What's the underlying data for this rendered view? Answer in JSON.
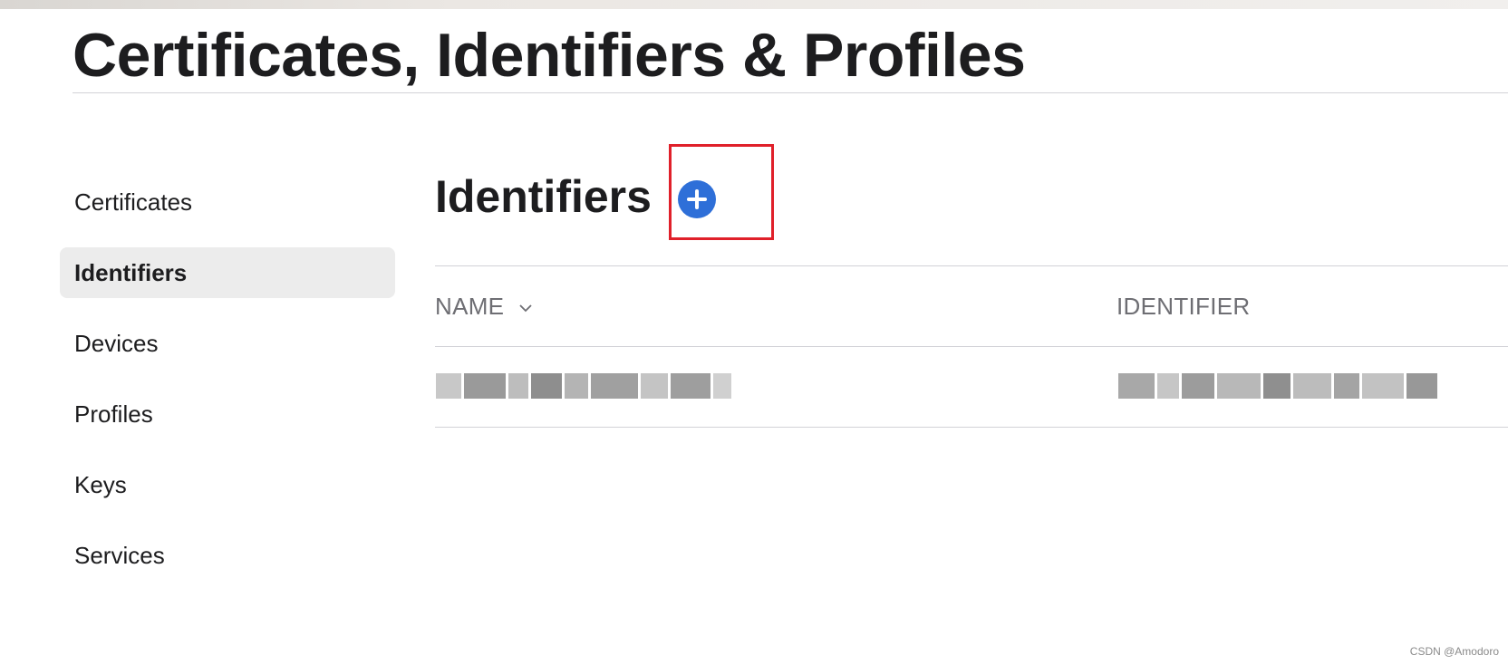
{
  "page": {
    "title": "Certificates, Identifiers & Profiles"
  },
  "sidebar": {
    "items": [
      {
        "label": "Certificates",
        "active": false
      },
      {
        "label": "Identifiers",
        "active": true
      },
      {
        "label": "Devices",
        "active": false
      },
      {
        "label": "Profiles",
        "active": false
      },
      {
        "label": "Keys",
        "active": false
      },
      {
        "label": "Services",
        "active": false
      }
    ]
  },
  "main": {
    "section_title": "Identifiers",
    "add_icon": "plus-circle-icon",
    "columns": [
      {
        "label": "NAME",
        "sortable": true,
        "sort_icon": "chevron-down-icon"
      },
      {
        "label": "IDENTIFIER"
      }
    ],
    "rows": [
      {
        "name": "[redacted]",
        "identifier": "[redacted]"
      }
    ]
  },
  "colors": {
    "accent": "#2e6fd8",
    "highlight": "#e0202a",
    "active_bg": "#ececec"
  },
  "watermark": "CSDN @Amodoro"
}
